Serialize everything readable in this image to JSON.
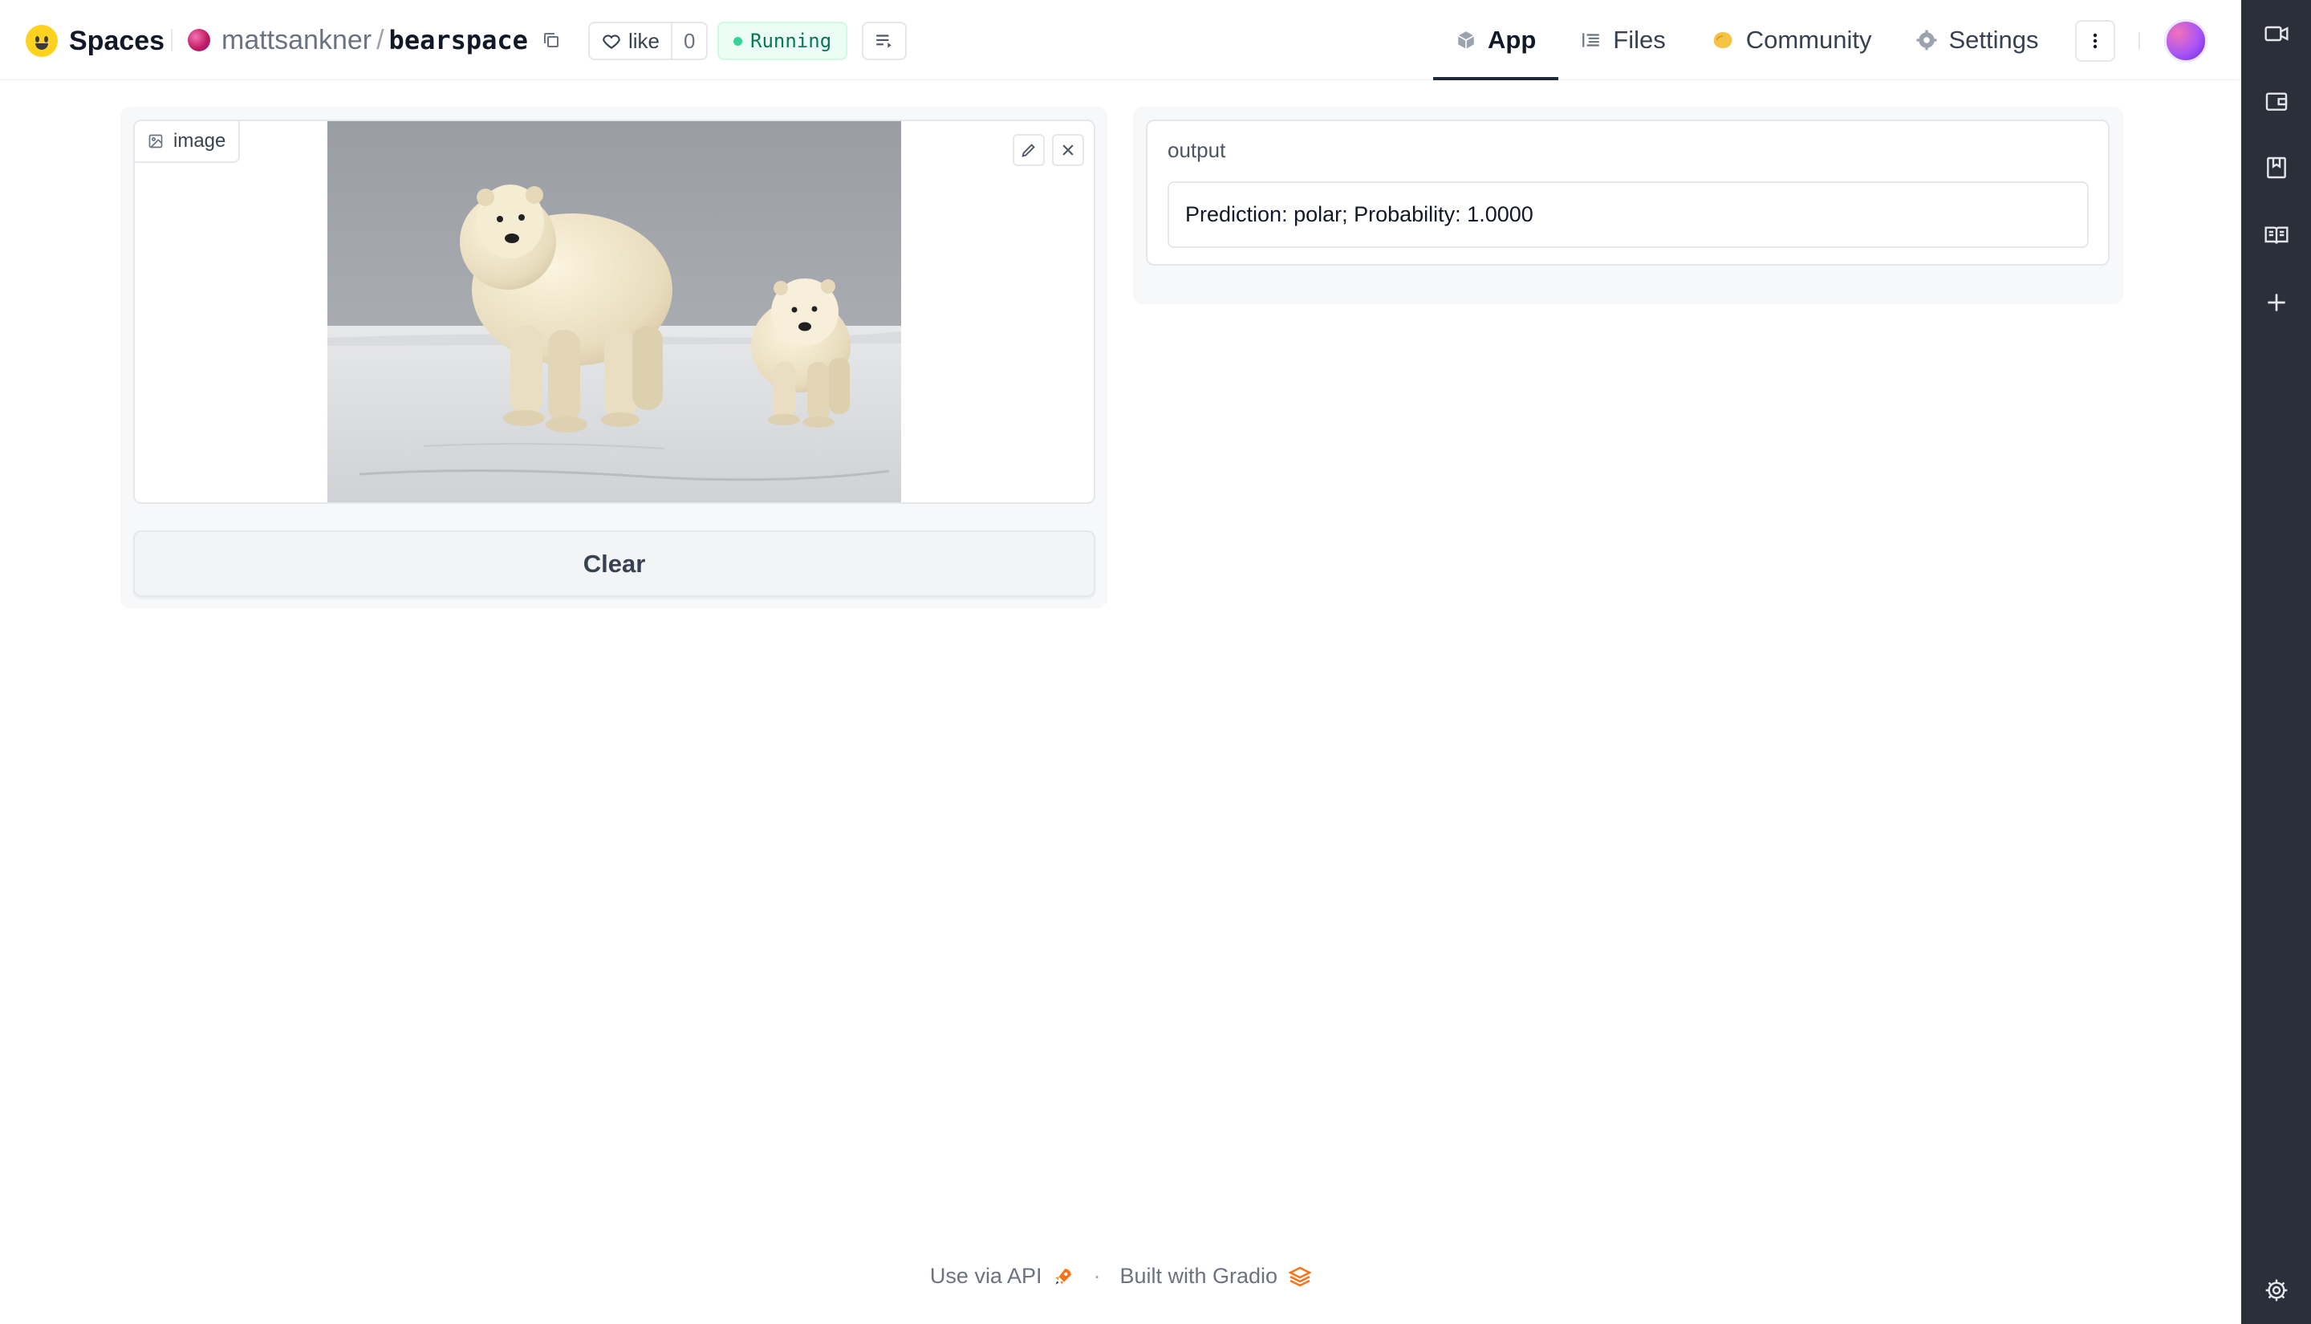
{
  "header": {
    "brand": "Spaces",
    "owner": "mattsankner",
    "separator": "/",
    "repo_name": "bearspace",
    "like_label": "like",
    "like_count": "0",
    "status": "Running",
    "status_color": "#34d399",
    "tabs": [
      {
        "label": "App",
        "icon": "app-cube-icon",
        "active": true
      },
      {
        "label": "Files",
        "icon": "files-icon",
        "active": false
      },
      {
        "label": "Community",
        "icon": "community-icon",
        "active": false
      },
      {
        "label": "Settings",
        "icon": "gear-icon",
        "active": false
      }
    ]
  },
  "sidebar_rail": {
    "icons": [
      "video-icon",
      "wallet-icon",
      "bookmark-icon",
      "book-icon",
      "plus-icon",
      "settings-icon"
    ],
    "background": "#2b2f3a"
  },
  "input": {
    "label": "image",
    "image_description_icon": "image-icon",
    "tools": [
      "edit-icon",
      "close-icon"
    ]
  },
  "buttons": {
    "clear": "Clear"
  },
  "output": {
    "label": "output",
    "value": "Prediction: polar; Probability: 1.0000"
  },
  "footer": {
    "api_link": "Use via API",
    "separator": "·",
    "built_with": "Built with Gradio"
  }
}
